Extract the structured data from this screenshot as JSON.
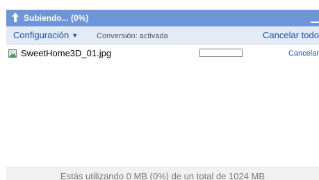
{
  "header": {
    "title": "Subiendo... (0%)",
    "icon": "upload-arrow-icon",
    "background_color": "#6f95d9"
  },
  "toolbar": {
    "settings_label": "Configuración",
    "settings_caret": "▼",
    "conversion_status": "Conversión: activada",
    "cancel_all_label": "Cancelar todo"
  },
  "files": [
    {
      "name": "SweetHome3D_01.jpg",
      "icon": "image-file-icon",
      "progress": 0,
      "cancel_label": "Cancelar"
    }
  ],
  "footer": {
    "usage_text": "Estás utilizando 0 MB (0%) de un total de 1024 MB"
  }
}
